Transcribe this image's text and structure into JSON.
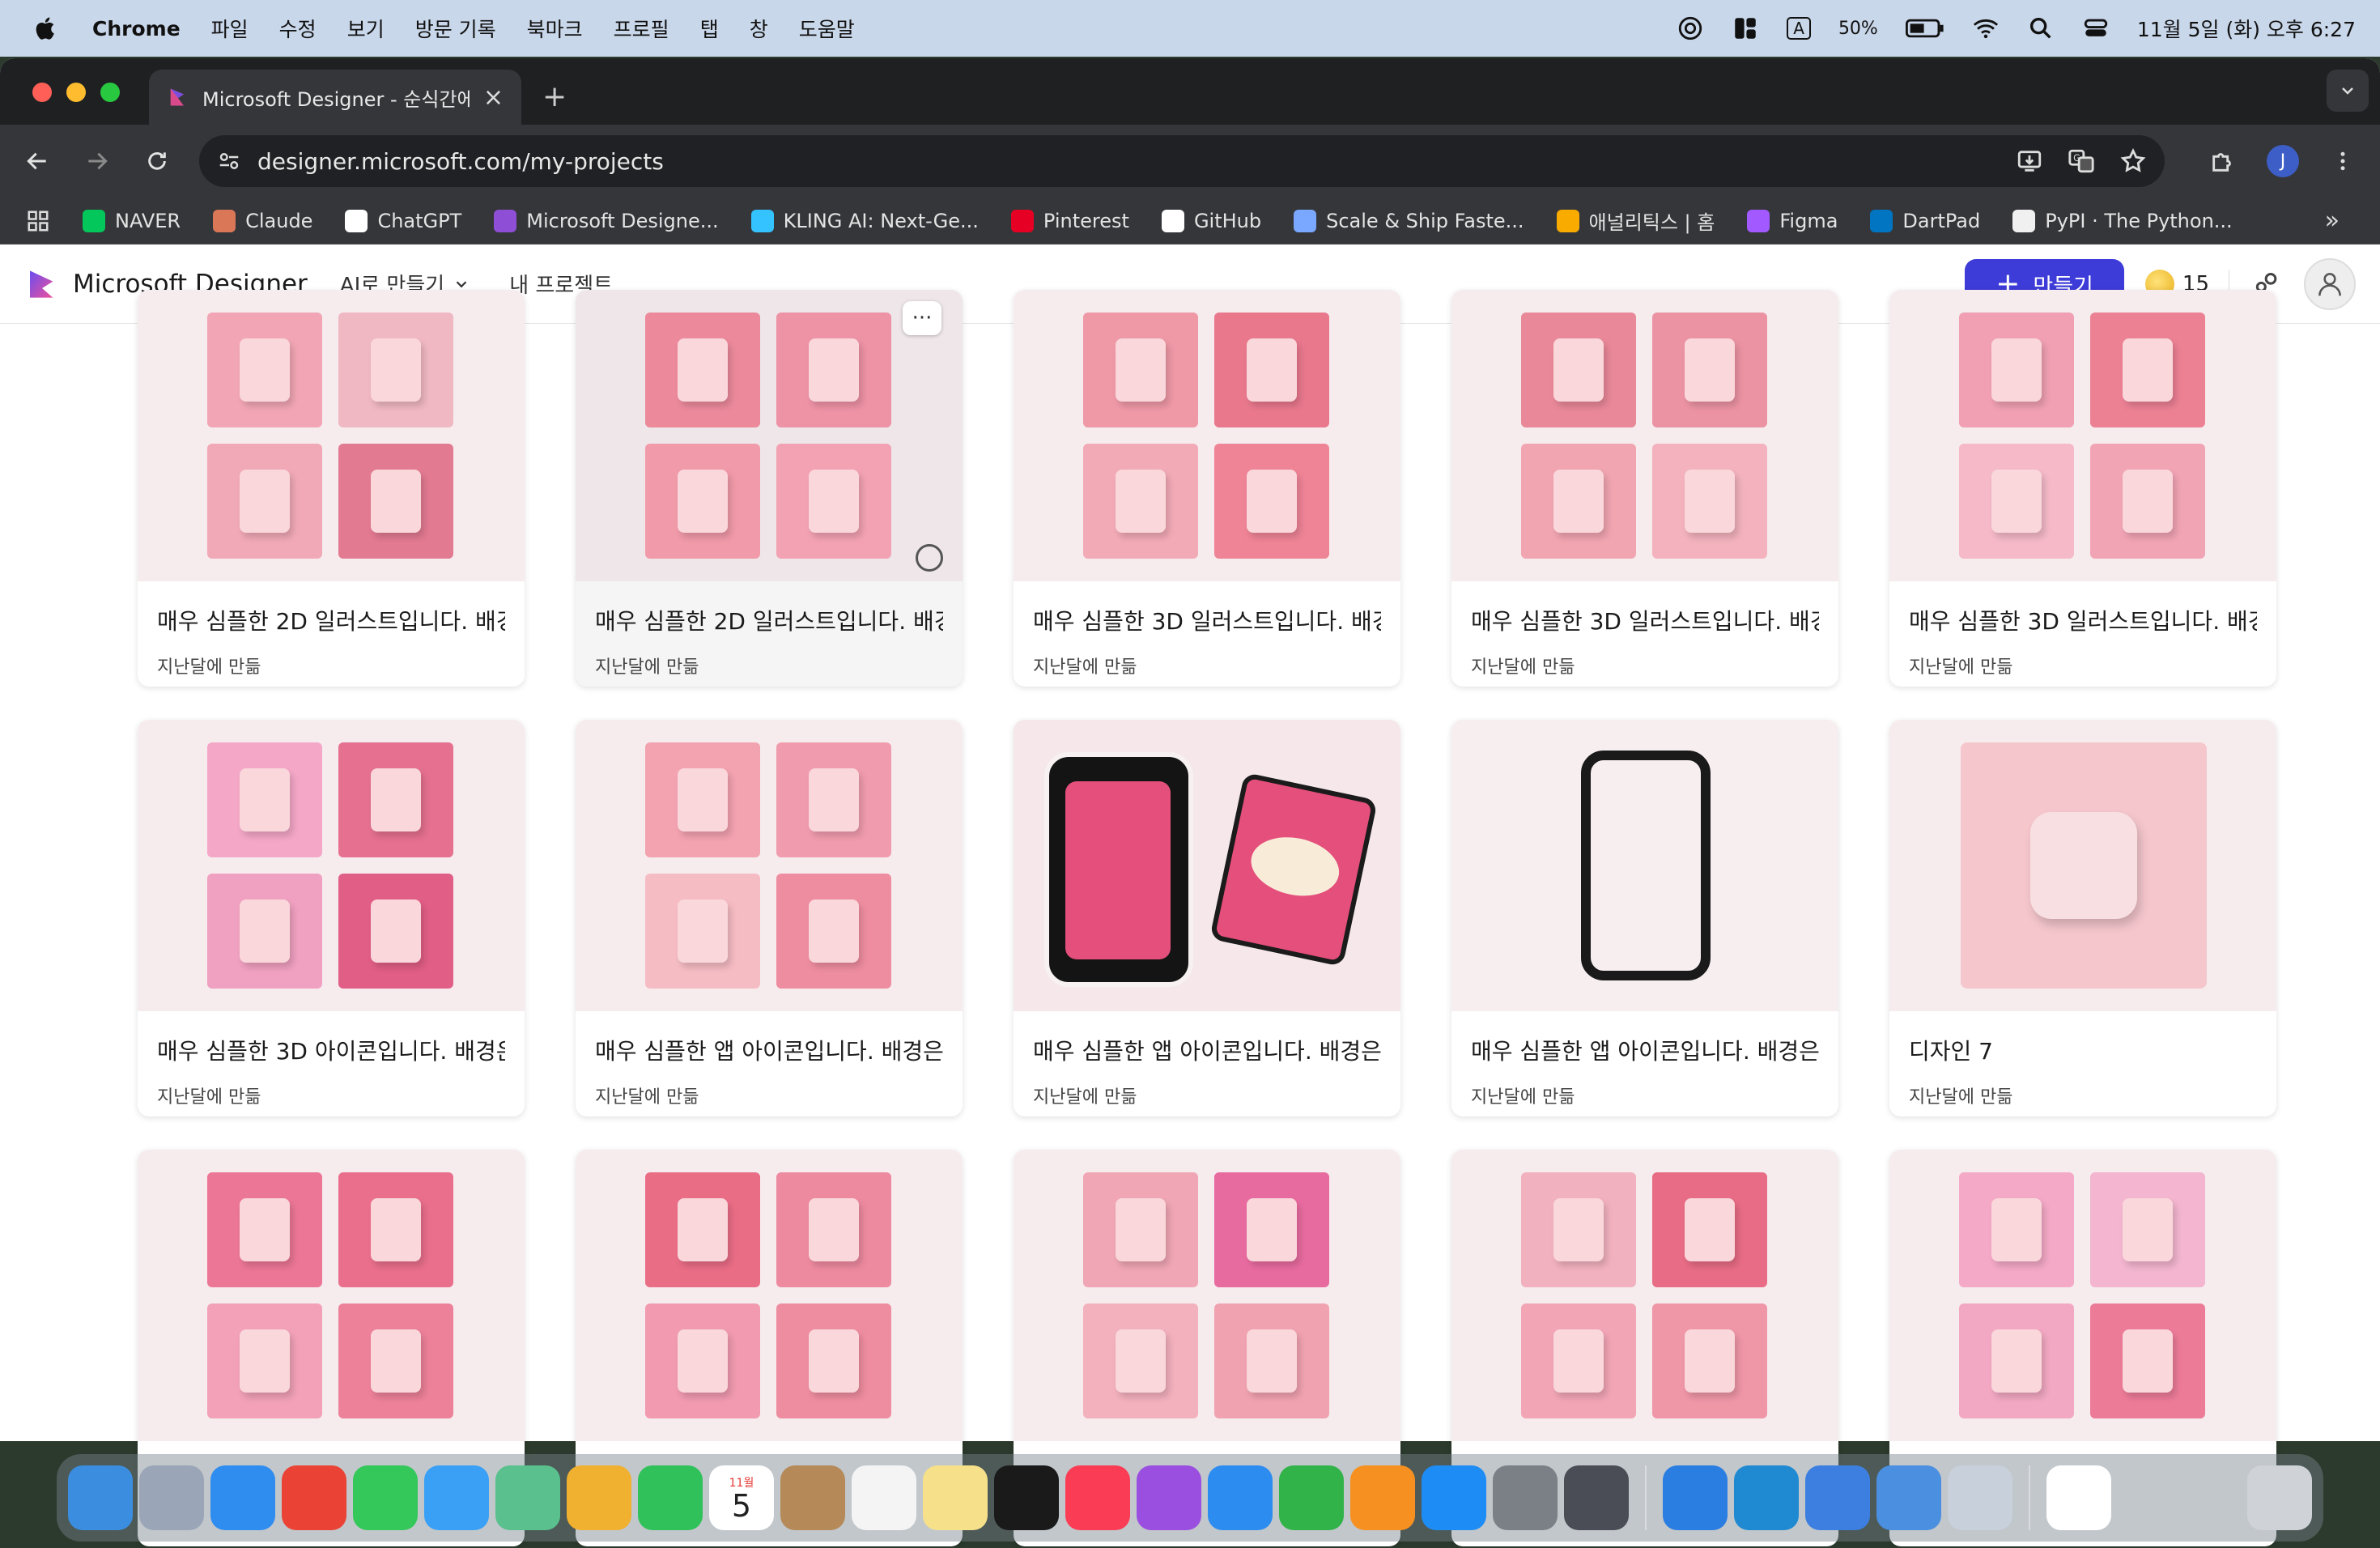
{
  "menubar": {
    "app": "Chrome",
    "items": [
      "파일",
      "수정",
      "보기",
      "방문 기록",
      "북마크",
      "프로필",
      "탭",
      "창",
      "도움말"
    ],
    "battery": "50%",
    "input_mode": "A",
    "clock": "11월 5일 (화) 오후 6:27"
  },
  "browser": {
    "tab_title": "Microsoft Designer - 순식간에",
    "url": "designer.microsoft.com/my-projects",
    "profile_initial": "J",
    "bookmarks": [
      {
        "label": "NAVER",
        "color": "#03c75a"
      },
      {
        "label": "Claude",
        "color": "#d97757"
      },
      {
        "label": "ChatGPT",
        "color": "#ffffff"
      },
      {
        "label": "Microsoft Designe...",
        "color": "#8e4fd6"
      },
      {
        "label": "KLING AI: Next-Ge...",
        "color": "#34c3ff"
      },
      {
        "label": "Pinterest",
        "color": "#e60023"
      },
      {
        "label": "GitHub",
        "color": "#ffffff"
      },
      {
        "label": "Scale & Ship Faste...",
        "color": "#7aa7ff"
      },
      {
        "label": "애널리틱스 | 홈",
        "color": "#f9ab00"
      },
      {
        "label": "Figma",
        "color": "#a259ff"
      },
      {
        "label": "DartPad",
        "color": "#0175c2"
      },
      {
        "label": "PyPI · The Python...",
        "color": "#f0f0f0"
      }
    ]
  },
  "app": {
    "brand": "Microsoft Designer",
    "nav_ai": "AI로 만들기",
    "nav_projects": "내 프로젝트",
    "create_label": "만들기",
    "credits": "15"
  },
  "cards": [
    {
      "title": "매우 심플한 2D 일러스트입니다. 배경...",
      "date": "지난달에 만듦",
      "layout": "quad",
      "colors": [
        "#f2a6b5",
        "#f0b8c2",
        "#f1a9b7",
        "#e27a92"
      ]
    },
    {
      "title": "매우 심플한 2D 일러스트입니다. 배경...",
      "date": "지난달에 만듦",
      "layout": "quad",
      "colors": [
        "#ec8a9c",
        "#ee92a6",
        "#f19aa9",
        "#f3a2b3"
      ]
    },
    {
      "title": "매우 심플한 3D 일러스트입니다. 배경...",
      "date": "지난달에 만듦",
      "layout": "quad",
      "colors": [
        "#ef98a6",
        "#e9788d",
        "#f2aab7",
        "#ee8496"
      ]
    },
    {
      "title": "매우 심플한 3D 일러스트입니다. 배경...",
      "date": "지난달에 만듦",
      "layout": "quad",
      "colors": [
        "#e98898",
        "#ec93a3",
        "#f1a5b1",
        "#f3b2bd"
      ]
    },
    {
      "title": "매우 심플한 3D 일러스트입니다. 배경...",
      "date": "지난달에 만듦",
      "layout": "quad",
      "colors": [
        "#f0a0b2",
        "#ec8194",
        "#f5b9c8",
        "#f1a4b4"
      ]
    },
    {
      "title": "매우 심플한 3D 아이콘입니다. 배경은...",
      "date": "지난달에 만듦",
      "layout": "quad",
      "colors": [
        "#f4a7c7",
        "#e5708f",
        "#f0a0c0",
        "#e15e86"
      ]
    },
    {
      "title": "매우 심플한 앱 아이콘입니다. 배경은 ...",
      "date": "지난달에 만듦",
      "layout": "quad",
      "colors": [
        "#f3a2b0",
        "#f19cae",
        "#f6bcc4",
        "#ef8da0"
      ]
    },
    {
      "title": "매우 심플한 앱 아이콘입니다. 배경은 ...",
      "date": "지난달에 만듦",
      "layout": "pair",
      "colors": [
        "#f5e7ea",
        "#e44f7c"
      ]
    },
    {
      "title": "매우 심플한 앱 아이콘입니다. 배경은 ...",
      "date": "지난달에 만듦",
      "layout": "single",
      "colors": [
        "#f7eef0",
        "#f0a8b5"
      ]
    },
    {
      "title": "디자인 7",
      "date": "지난달에 만듦",
      "layout": "single",
      "colors": [
        "#ef7a92",
        "#f5c7cd"
      ]
    },
    {
      "title": "",
      "date": "",
      "layout": "quad",
      "colors": [
        "#ec7696",
        "#e96f8c",
        "#f2a1b8",
        "#ec8199"
      ]
    },
    {
      "title": "",
      "date": "",
      "layout": "quad",
      "colors": [
        "#ea6d86",
        "#ee8aa0",
        "#f19ab0",
        "#ef8da0"
      ]
    },
    {
      "title": "",
      "date": "",
      "layout": "quad",
      "colors": [
        "#f0a6b4",
        "#e86b9f",
        "#f3b0bd",
        "#f1a2b0"
      ]
    },
    {
      "title": "",
      "date": "",
      "layout": "quad",
      "colors": [
        "#f2b1bf",
        "#e86c85",
        "#f2a5b5",
        "#ef96a7"
      ]
    },
    {
      "title": "",
      "date": "",
      "layout": "quad",
      "colors": [
        "#f4a9c6",
        "#f3b5cf",
        "#f2a8c2",
        "#ec7b98"
      ]
    }
  ],
  "dock": [
    {
      "name": "finder",
      "color": "#3b8de0"
    },
    {
      "name": "launchpad",
      "color": "#9aa6b8"
    },
    {
      "name": "safari",
      "color": "#2f8df0"
    },
    {
      "name": "chrome",
      "color": "#ea4335"
    },
    {
      "name": "messages",
      "color": "#34c759"
    },
    {
      "name": "mail",
      "color": "#3aa0f5"
    },
    {
      "name": "maps",
      "color": "#5ac18e"
    },
    {
      "name": "photos",
      "color": "#f0b030"
    },
    {
      "name": "facetime",
      "color": "#30c15a"
    },
    {
      "name": "calendar",
      "color": "#ffffff"
    },
    {
      "name": "contacts",
      "color": "#b58a58"
    },
    {
      "name": "reminders",
      "color": "#f4f4f4"
    },
    {
      "name": "notes",
      "color": "#f7e08a"
    },
    {
      "name": "tv",
      "color": "#1a1a1a"
    },
    {
      "name": "music",
      "color": "#fa3d55"
    },
    {
      "name": "podcasts",
      "color": "#9b4fe0"
    },
    {
      "name": "keynote",
      "color": "#2d8cf0"
    },
    {
      "name": "numbers",
      "color": "#32b34a"
    },
    {
      "name": "pages",
      "color": "#f69020"
    },
    {
      "name": "app-store",
      "color": "#1e8cf5"
    },
    {
      "name": "system-settings",
      "color": "#7b7f86"
    },
    {
      "name": "iphone-mirroring",
      "color": "#4a4d55"
    },
    {
      "name": "xcode-instruments",
      "color": "#2a7de1"
    },
    {
      "name": "vscode",
      "color": "#1f8ad2"
    },
    {
      "name": "xcode",
      "color": "#3d7fe0"
    },
    {
      "name": "simulator",
      "color": "#4b8fe0"
    },
    {
      "name": "preview",
      "color": "#c8d0dc"
    },
    {
      "name": "chatgpt",
      "color": "#ffffff"
    }
  ],
  "calendar_icon": {
    "month": "11월",
    "day": "5"
  }
}
